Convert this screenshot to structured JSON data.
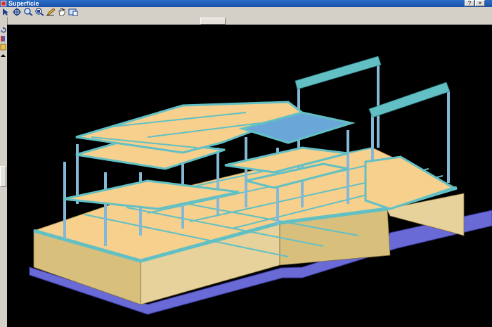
{
  "window": {
    "title": "Superficie",
    "help_btn": "?",
    "close_btn": "×"
  },
  "toolbar": {
    "icons": [
      "select-arrow-icon",
      "pan-move-icon",
      "zoom-icon",
      "zoom-window-icon",
      "pen-edit-icon",
      "hand-icon",
      "view-icon"
    ]
  },
  "side_toolbar": {
    "icons": [
      "rotate-icon",
      "color-icon",
      "layers-icon",
      "scroll-up-icon"
    ]
  },
  "colors": {
    "slab": "#f6d08c",
    "beam": "#62c0c4",
    "column": "#84b8d8",
    "foundation": "#d8c07c",
    "base": "#6a6ad6",
    "glass": "#6aa6d8"
  }
}
